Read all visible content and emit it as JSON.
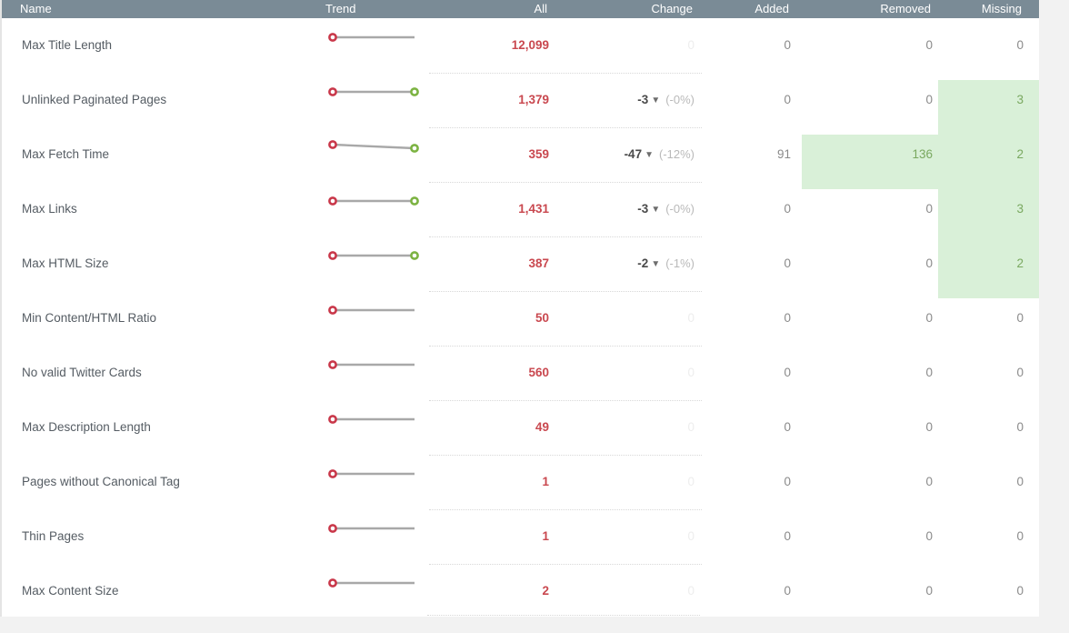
{
  "table": {
    "columns": [
      {
        "key": "name",
        "label": "Name"
      },
      {
        "key": "trend",
        "label": "Trend"
      },
      {
        "key": "all",
        "label": "All"
      },
      {
        "key": "change",
        "label": "Change"
      },
      {
        "key": "added",
        "label": "Added"
      },
      {
        "key": "removed",
        "label": "Removed"
      },
      {
        "key": "missing",
        "label": "Missing"
      }
    ],
    "rows": [
      {
        "name": "Max Title Length",
        "all": "12,099",
        "change_value": "",
        "change_arrow": "",
        "change_percent": "",
        "change_zero": "0",
        "added": "0",
        "removed": "0",
        "missing": "0",
        "trend_has_end_marker": false,
        "trend_slope": 0,
        "added_highlight": false,
        "removed_highlight": false,
        "missing_highlight": false
      },
      {
        "name": "Unlinked Paginated Pages",
        "all": "1,379",
        "change_value": "-3",
        "change_arrow": "▼",
        "change_percent": "(-0%)",
        "change_zero": "",
        "added": "0",
        "removed": "0",
        "missing": "3",
        "trend_has_end_marker": true,
        "trend_slope": 0,
        "added_highlight": false,
        "removed_highlight": false,
        "missing_highlight": true
      },
      {
        "name": "Max Fetch Time",
        "all": "359",
        "change_value": "-47",
        "change_arrow": "▼",
        "change_percent": "(-12%)",
        "change_zero": "",
        "added": "91",
        "removed": "136",
        "missing": "2",
        "trend_has_end_marker": true,
        "trend_slope": 4,
        "added_highlight": false,
        "removed_highlight": true,
        "missing_highlight": true
      },
      {
        "name": "Max Links",
        "all": "1,431",
        "change_value": "-3",
        "change_arrow": "▼",
        "change_percent": "(-0%)",
        "change_zero": "",
        "added": "0",
        "removed": "0",
        "missing": "3",
        "trend_has_end_marker": true,
        "trend_slope": 0,
        "added_highlight": false,
        "removed_highlight": false,
        "missing_highlight": true
      },
      {
        "name": "Max HTML Size",
        "all": "387",
        "change_value": "-2",
        "change_arrow": "▼",
        "change_percent": "(-1%)",
        "change_zero": "",
        "added": "0",
        "removed": "0",
        "missing": "2",
        "trend_has_end_marker": true,
        "trend_slope": 0,
        "added_highlight": false,
        "removed_highlight": false,
        "missing_highlight": true
      },
      {
        "name": "Min Content/HTML Ratio",
        "all": "50",
        "change_value": "",
        "change_arrow": "",
        "change_percent": "",
        "change_zero": "0",
        "added": "0",
        "removed": "0",
        "missing": "0",
        "trend_has_end_marker": false,
        "trend_slope": 0,
        "added_highlight": false,
        "removed_highlight": false,
        "missing_highlight": false
      },
      {
        "name": "No valid Twitter Cards",
        "all": "560",
        "change_value": "",
        "change_arrow": "",
        "change_percent": "",
        "change_zero": "0",
        "added": "0",
        "removed": "0",
        "missing": "0",
        "trend_has_end_marker": false,
        "trend_slope": 0,
        "added_highlight": false,
        "removed_highlight": false,
        "missing_highlight": false
      },
      {
        "name": "Max Description Length",
        "all": "49",
        "change_value": "",
        "change_arrow": "",
        "change_percent": "",
        "change_zero": "0",
        "added": "0",
        "removed": "0",
        "missing": "0",
        "trend_has_end_marker": false,
        "trend_slope": 0,
        "added_highlight": false,
        "removed_highlight": false,
        "missing_highlight": false
      },
      {
        "name": "Pages without Canonical Tag",
        "all": "1",
        "change_value": "",
        "change_arrow": "",
        "change_percent": "",
        "change_zero": "0",
        "added": "0",
        "removed": "0",
        "missing": "0",
        "trend_has_end_marker": false,
        "trend_slope": 0,
        "added_highlight": false,
        "removed_highlight": false,
        "missing_highlight": false
      },
      {
        "name": "Thin Pages",
        "all": "1",
        "change_value": "",
        "change_arrow": "",
        "change_percent": "",
        "change_zero": "0",
        "added": "0",
        "removed": "0",
        "missing": "0",
        "trend_has_end_marker": false,
        "trend_slope": 0,
        "added_highlight": false,
        "removed_highlight": false,
        "missing_highlight": false
      },
      {
        "name": "Max Content Size",
        "all": "2",
        "change_value": "",
        "change_arrow": "",
        "change_percent": "",
        "change_zero": "0",
        "added": "0",
        "removed": "0",
        "missing": "0",
        "trend_has_end_marker": false,
        "trend_slope": 0,
        "added_highlight": false,
        "removed_highlight": false,
        "missing_highlight": false
      }
    ]
  },
  "colors": {
    "header_bg": "#7a8b96",
    "header_text": "#ffffff",
    "value_red": "#c9484f",
    "highlight_green_bg": "#d9f0d8",
    "highlight_green_text": "#79a85f",
    "trend_start_marker": "#c9384a",
    "trend_end_marker": "#7cb342",
    "trend_line": "#a8a8a8",
    "muted_text": "#8a8a8a",
    "faint_text": "#ededed",
    "page_bg": "#f2f2f2"
  }
}
